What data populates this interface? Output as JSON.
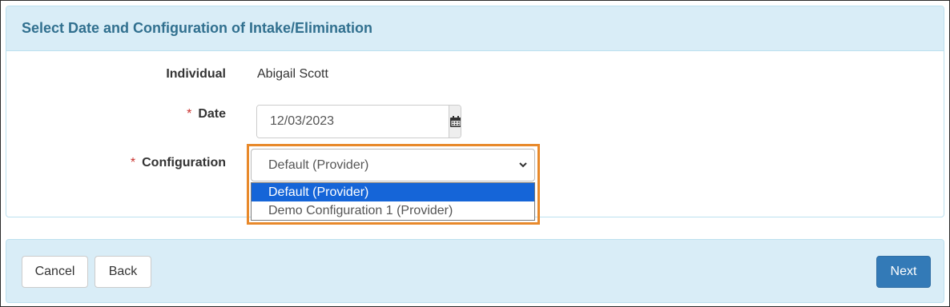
{
  "panel": {
    "title": "Select Date and Configuration of Intake/Elimination"
  },
  "form": {
    "individual": {
      "label": "Individual",
      "value": "Abigail Scott"
    },
    "date": {
      "label": "Date",
      "required_marker": "*",
      "value": "12/03/2023",
      "icon": "calendar-icon"
    },
    "configuration": {
      "label": "Configuration",
      "required_marker": "*",
      "selected": "Default (Provider)",
      "options": [
        "Default (Provider)",
        "Demo Configuration 1 (Provider)"
      ],
      "highlight_color": "#e8892b"
    }
  },
  "footer": {
    "cancel_label": "Cancel",
    "back_label": "Back",
    "next_label": "Next"
  },
  "colors": {
    "heading_bg": "#d9edf7",
    "heading_text": "#31708f",
    "primary": "#337ab7",
    "option_selected": "#1565d8",
    "required": "#c9302c"
  }
}
